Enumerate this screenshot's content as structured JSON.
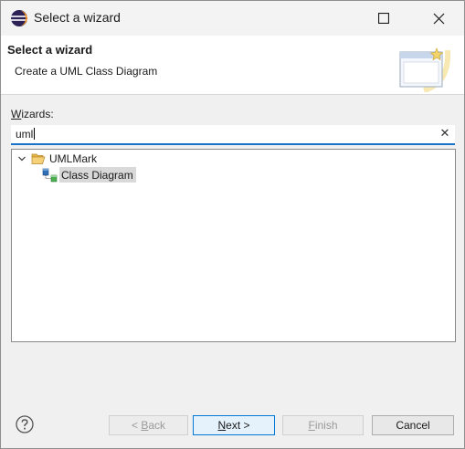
{
  "window": {
    "title": "Select a wizard"
  },
  "banner": {
    "title": "Select a wizard",
    "description": "Create a UML Class Diagram"
  },
  "filter": {
    "label_mnemonic": "W",
    "label_rest": "izards:",
    "value": "uml"
  },
  "tree": {
    "items": [
      {
        "label": "UMLMark",
        "type": "folder",
        "expanded": true
      },
      {
        "label": "Class Diagram",
        "type": "wizard",
        "selected": true
      }
    ]
  },
  "buttons": {
    "back": {
      "prefix": "< ",
      "mnemonic": "B",
      "rest": "ack"
    },
    "next": {
      "mnemonic": "N",
      "rest": "ext >"
    },
    "finish": {
      "mnemonic": "F",
      "rest": "inish"
    },
    "cancel": "Cancel"
  },
  "colors": {
    "accent": "#1a73c7",
    "selection": "#d9d9d9",
    "folder": "#e8b84a"
  }
}
